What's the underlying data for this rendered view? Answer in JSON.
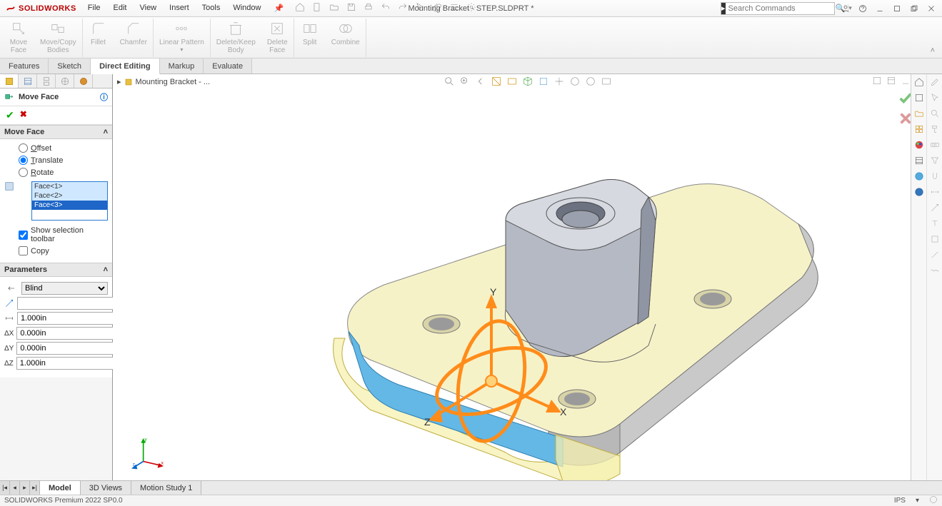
{
  "app": {
    "brand": "SOLIDWORKS",
    "doc_title": "Mounting Bracket - STEP.SLDPRT *"
  },
  "menu": {
    "items": [
      "File",
      "Edit",
      "View",
      "Insert",
      "Tools",
      "Window"
    ]
  },
  "search": {
    "placeholder": "Search Commands"
  },
  "ribbon": {
    "buttons": [
      {
        "label": "Move\nFace"
      },
      {
        "label": "Move/Copy\nBodies"
      },
      {
        "label": "Fillet"
      },
      {
        "label": "Chamfer"
      },
      {
        "label": "Linear Pattern"
      },
      {
        "label": "Delete/Keep\nBody"
      },
      {
        "label": "Delete\nFace"
      },
      {
        "label": "Split"
      },
      {
        "label": "Combine"
      }
    ],
    "groups": [
      2,
      2,
      1,
      2,
      2
    ]
  },
  "cmd_tabs": [
    "Features",
    "Sketch",
    "Direct Editing",
    "Markup",
    "Evaluate"
  ],
  "cmd_tabs_active": 2,
  "breadcrumb": "Mounting Bracket - ...",
  "pm": {
    "title": "Move Face",
    "group1": "Move Face",
    "radios": [
      {
        "label": "Offset",
        "key": "O",
        "checked": false
      },
      {
        "label": "Translate",
        "key": "T",
        "checked": true
      },
      {
        "label": "Rotate",
        "key": "R",
        "checked": false
      }
    ],
    "faces": [
      "Face<1>",
      "Face<2>",
      "Face<3>"
    ],
    "faces_selected": 2,
    "chk_toolbar": {
      "label": "Show selection toolbar",
      "checked": true
    },
    "chk_copy": {
      "label": "Copy",
      "checked": false
    },
    "group2": "Parameters",
    "end_condition": "Blind",
    "direction_value": "",
    "distance": "1.000in",
    "dx": "0.000in",
    "dy": "0.000in",
    "dz": "1.000in",
    "labels": {
      "dx": "ΔX",
      "dy": "ΔY",
      "dz": "ΔZ"
    }
  },
  "bottom_tabs": [
    "Model",
    "3D Views",
    "Motion Study 1"
  ],
  "bottom_tabs_active": 0,
  "status": {
    "left": "SOLIDWORKS Premium 2022 SP0.0",
    "units": "IPS"
  },
  "triad_labels": {
    "x": "X",
    "y": "Y",
    "z": "Z"
  }
}
